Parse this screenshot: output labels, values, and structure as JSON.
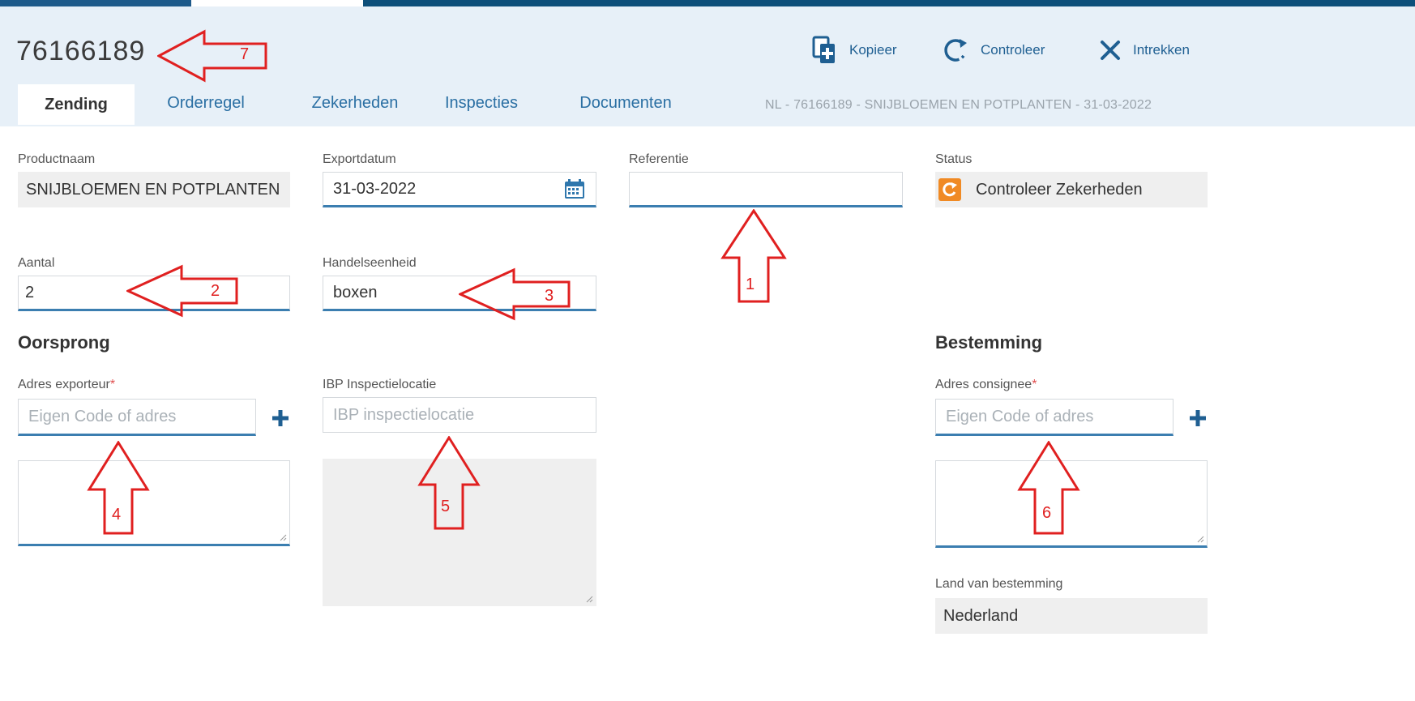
{
  "header": {
    "title": "76166189",
    "actions": [
      {
        "label": "Kopieer",
        "icon": "copy-icon"
      },
      {
        "label": "Controleer",
        "icon": "refresh-icon"
      },
      {
        "label": "Intrekken",
        "icon": "close-icon"
      }
    ],
    "tabs": [
      "Zending",
      "Orderregel",
      "Zekerheden",
      "Inspecties",
      "Documenten"
    ],
    "active_tab": "Zending",
    "breadcrumb": "NL - 76166189 - SNIJBLOEMEN EN POTPLANTEN - 31-03-2022"
  },
  "form": {
    "productnaam_label": "Productnaam",
    "productnaam_value": "SNIJBLOEMEN EN POTPLANTEN",
    "exportdatum_label": "Exportdatum",
    "exportdatum_value": "31-03-2022",
    "referentie_label": "Referentie",
    "referentie_value": "",
    "status_label": "Status",
    "status_value": "Controleer Zekerheden",
    "aantal_label": "Aantal",
    "aantal_value": "2",
    "handelseenheid_label": "Handelseenheid",
    "handelseenheid_value": "boxen"
  },
  "oorsprong": {
    "heading": "Oorsprong",
    "adres_label": "Adres exporteur",
    "adres_required": "*",
    "adres_placeholder": "Eigen Code of adres",
    "ibp_label": "IBP Inspectielocatie",
    "ibp_placeholder": "IBP inspectielocatie"
  },
  "bestemming": {
    "heading": "Bestemming",
    "adres_label": "Adres consignee",
    "adres_required": "*",
    "adres_placeholder": "Eigen Code of adres",
    "land_label": "Land van bestemming",
    "land_value": "Nederland"
  },
  "annotations": [
    "1",
    "2",
    "3",
    "4",
    "5",
    "6",
    "7"
  ],
  "colors": {
    "header_bg": "#e7f0f8",
    "accent_blue": "#1f5f92",
    "status_orange": "#f08a24",
    "annotation_red": "#e02020"
  }
}
